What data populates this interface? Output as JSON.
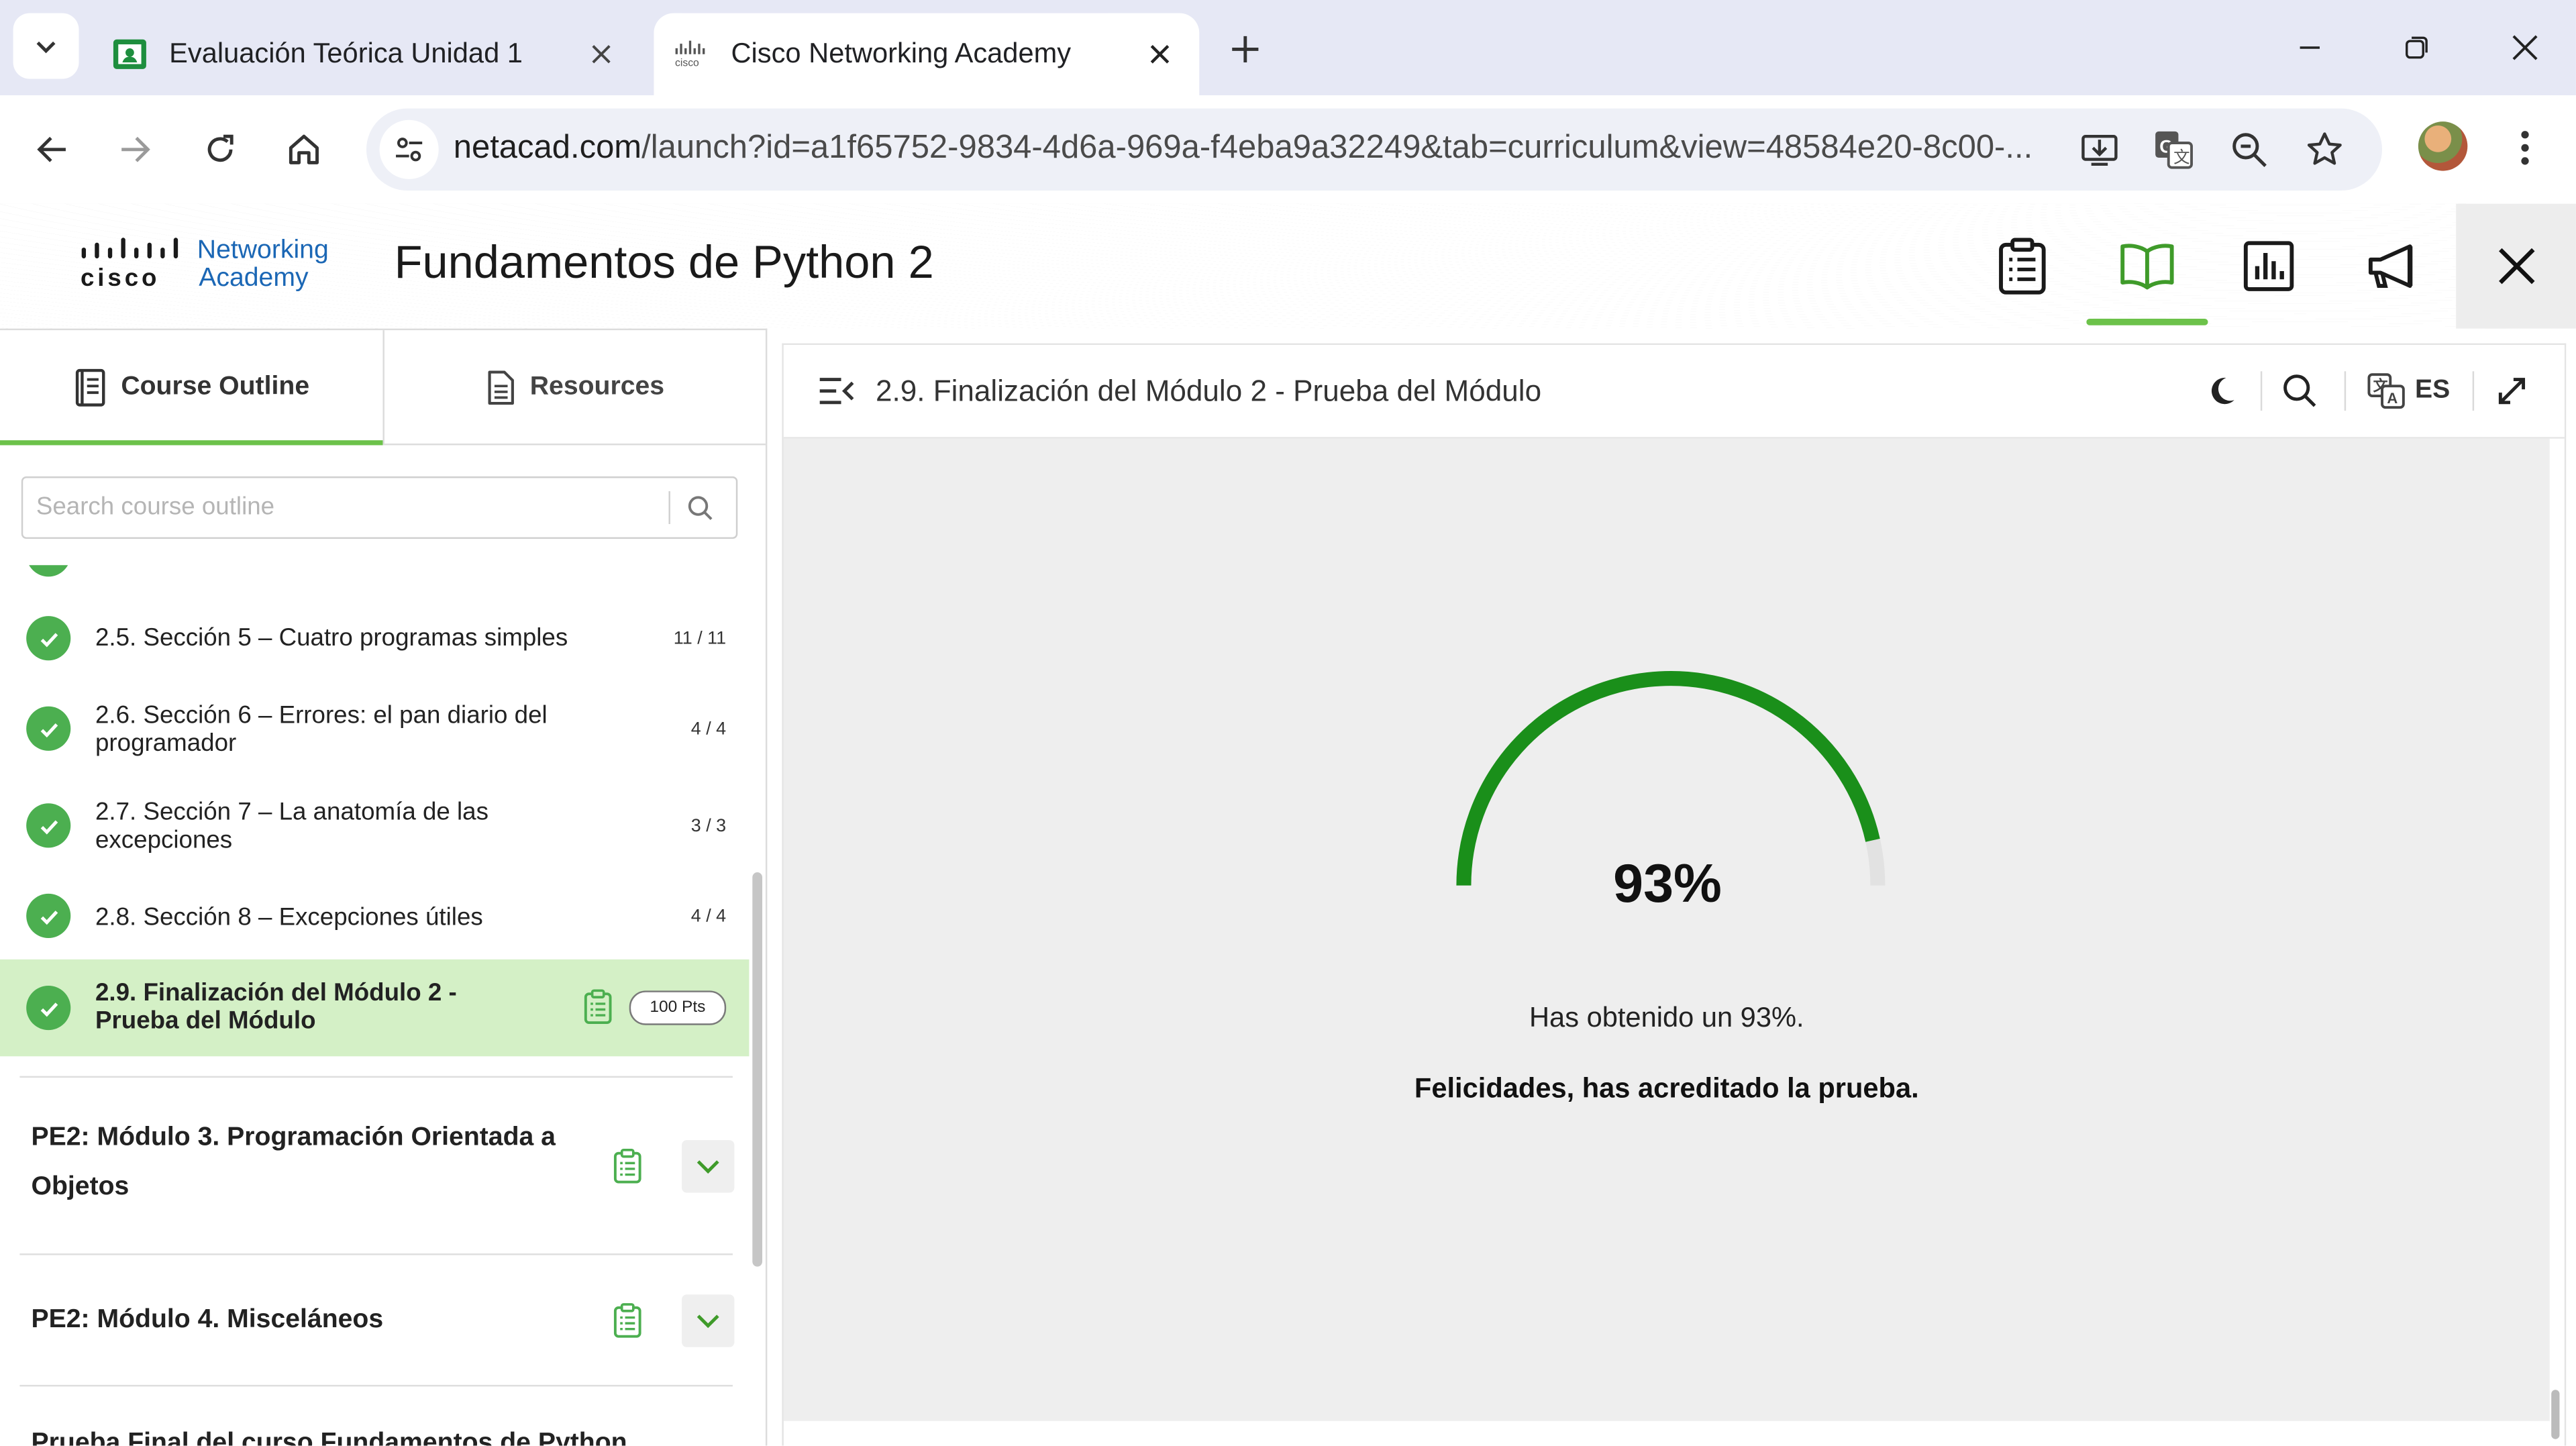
{
  "browser": {
    "tabs": [
      {
        "title": "Evaluación Teórica Unidad 1",
        "favicon": "google-classroom-icon",
        "active": false
      },
      {
        "title": "Cisco Networking Academy",
        "favicon": "cisco-icon",
        "active": true
      }
    ],
    "url_host": "netacad.com",
    "url_path": "/launch?id=a1f65752-9834-4d6a-969a-f4eba9a32249&tab=curriculum&view=48584e20-8c00-..."
  },
  "header": {
    "logo_brand": "cisco",
    "logo_line1": "Networking",
    "logo_line2": "Academy",
    "course_title": "Fundamentos de Python 2",
    "accent_color": "#6cc24a"
  },
  "sidebar": {
    "tabs": [
      {
        "label": "Course Outline"
      },
      {
        "label": "Resources"
      }
    ],
    "search_placeholder": "Search course outline",
    "sections": [
      {
        "label": "2.5. Sección 5 – Cuatro programas simples",
        "count": "11 / 11"
      },
      {
        "label": "2.6. Sección 6 – Errores: el pan diario del programador",
        "count": "4 / 4"
      },
      {
        "label": "2.7. Sección 7 – La anatomía de las excepciones",
        "count": "3 / 3"
      },
      {
        "label": "2.8. Sección 8 – Excepciones útiles",
        "count": "4 / 4"
      },
      {
        "label": "2.9. Finalización del Módulo 2 - Prueba del Módulo",
        "points": "100 Pts"
      }
    ],
    "modules": [
      {
        "title": "PE2: Módulo 3. Programación Orientada a Objetos"
      },
      {
        "title": "PE2: Módulo 4. Misceláneos"
      },
      {
        "title": "Prueba Final del curso Fundamentos de Python"
      }
    ]
  },
  "content": {
    "title": "2.9. Finalización del Módulo 2 - Prueba del Módulo",
    "language": "ES",
    "score_text": "93%",
    "score_fraction": 0.93,
    "score_color": "#1a8f1a",
    "message": "Has obtenido un 93%.",
    "result": "Felicidades, has acreditado la prueba."
  }
}
